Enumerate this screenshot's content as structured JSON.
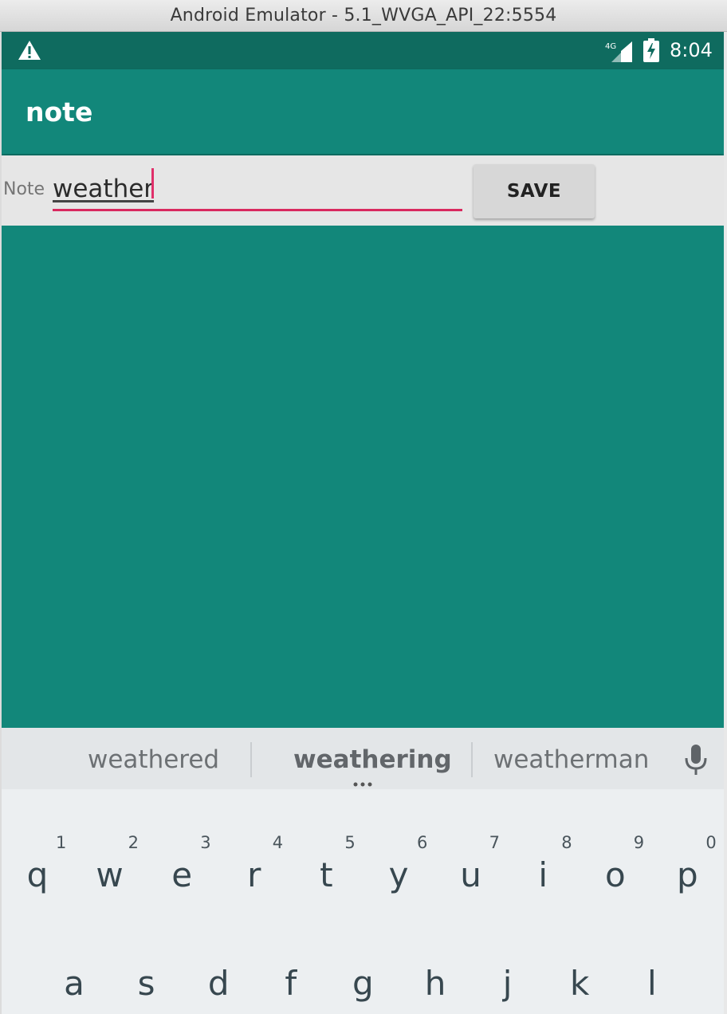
{
  "window": {
    "title": "Android Emulator - 5.1_WVGA_API_22:5554"
  },
  "status_bar": {
    "time": "8:04",
    "network_label": "4G",
    "icons": [
      "warning-icon",
      "signal-icon",
      "battery-charging-icon"
    ]
  },
  "app_bar": {
    "title": "note"
  },
  "form": {
    "label": "Note",
    "input_value": "weather",
    "save_label": "SAVE"
  },
  "keyboard": {
    "suggestions": [
      "weathered",
      "weathering",
      "weatherman"
    ],
    "row1": [
      {
        "letter": "q",
        "hint": "1"
      },
      {
        "letter": "w",
        "hint": "2"
      },
      {
        "letter": "e",
        "hint": "3"
      },
      {
        "letter": "r",
        "hint": "4"
      },
      {
        "letter": "t",
        "hint": "5"
      },
      {
        "letter": "y",
        "hint": "6"
      },
      {
        "letter": "u",
        "hint": "7"
      },
      {
        "letter": "i",
        "hint": "8"
      },
      {
        "letter": "o",
        "hint": "9"
      },
      {
        "letter": "p",
        "hint": "0"
      }
    ],
    "row2": [
      {
        "letter": "a"
      },
      {
        "letter": "s"
      },
      {
        "letter": "d"
      },
      {
        "letter": "f"
      },
      {
        "letter": "g"
      },
      {
        "letter": "h"
      },
      {
        "letter": "j"
      },
      {
        "letter": "k"
      },
      {
        "letter": "l"
      }
    ]
  },
  "colors": {
    "primary": "#12877a",
    "primary_dark": "#0f6b5f",
    "accent": "#d9295f",
    "input_row_bg": "#e6e6e6",
    "keyboard_bg": "#eceff1"
  }
}
